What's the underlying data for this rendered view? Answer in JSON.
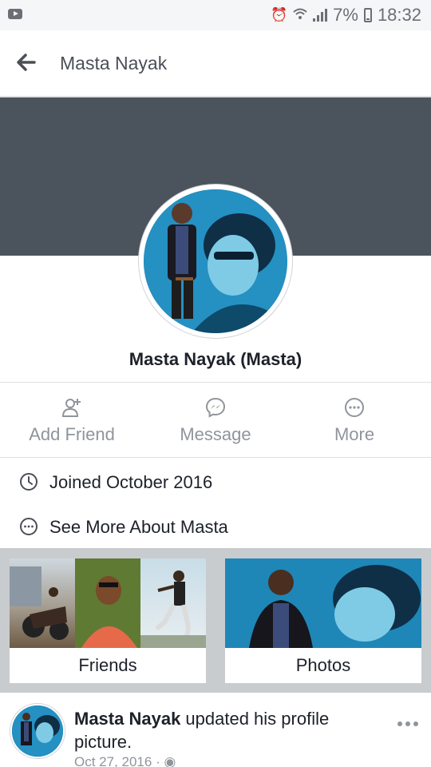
{
  "status_bar": {
    "time": "18:32",
    "battery_percent": "7%",
    "icons": [
      "youtube-notification-icon",
      "alarm-icon",
      "wifi-icon",
      "signal-icon",
      "battery-icon"
    ]
  },
  "header": {
    "title": "Masta Nayak",
    "back_icon": "back-arrow-icon"
  },
  "profile": {
    "name": "Masta Nayak (Masta)",
    "cover_color": "#4b545d"
  },
  "actions": [
    {
      "label": "Add Friend",
      "icon": "add-friend-icon"
    },
    {
      "label": "Message",
      "icon": "messenger-icon"
    },
    {
      "label": "More",
      "icon": "more-icon"
    }
  ],
  "about": [
    {
      "text": "Joined October 2016",
      "icon": "clock-icon"
    },
    {
      "text": "See More About Masta",
      "icon": "more-icon"
    }
  ],
  "cards": {
    "friends_label": "Friends",
    "photos_label": "Photos"
  },
  "post": {
    "author": "Masta Nayak",
    "action_text": " updated his profile picture.",
    "date": "Oct 27, 2016 ·",
    "privacy_icon": "globe-icon",
    "menu_icon": "more-options-icon"
  },
  "colors": {
    "accent_text": "#1d2129",
    "muted_text": "#90949c",
    "divider": "#dddfe2"
  }
}
